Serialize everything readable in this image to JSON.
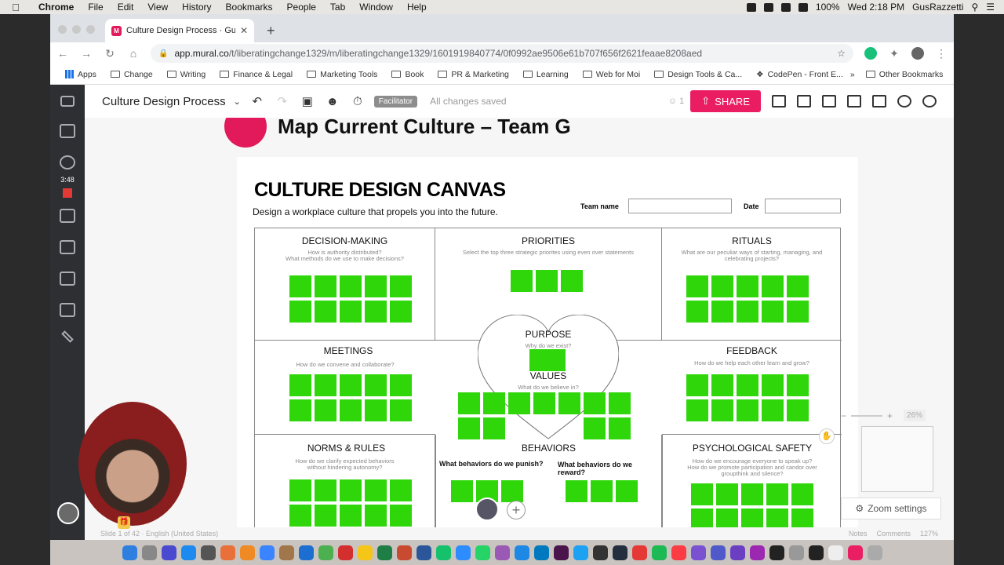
{
  "menubar": {
    "app": "Chrome",
    "items": [
      "File",
      "Edit",
      "View",
      "History",
      "Bookmarks",
      "People",
      "Tab",
      "Window",
      "Help"
    ],
    "battery": "100%",
    "clock": "Wed 2:18 PM",
    "user": "GusRazzetti"
  },
  "browser": {
    "tab_title": "Culture Design Process · Gust",
    "tab_favicon": "M",
    "url_host": "app.mural.co",
    "url_path": "/t/liberatingchange1329/m/liberatingchange1329/1601919840774/0f0992ae9506e61b707f656f2621feaae8208aed",
    "bookmarks": [
      "Apps",
      "Change",
      "Writing",
      "Finance & Legal",
      "Marketing Tools",
      "Book",
      "PR & Marketing",
      "Learning",
      "Web for Moi",
      "Design Tools & Ca...",
      "CodePen - Front E..."
    ],
    "bookmarks_more": "»",
    "other_bookmarks": "Other Bookmarks"
  },
  "recording_time": "3:48",
  "mural": {
    "title": "Culture Design Process",
    "facilitator": "Facilitator",
    "saved_status": "All changes saved",
    "user_count": "1",
    "share_label": "SHARE",
    "section_heading": "Map Current Culture – Team G",
    "canvas_title": "CULTURE DESIGN CANVAS",
    "canvas_subtitle": "Design a workplace culture that propels you into the future.",
    "team_name_label": "Team name",
    "date_label": "Date",
    "sections": {
      "decision": {
        "title": "DECISION-MAKING",
        "sub1": "How is authority distributed?",
        "sub2": "What methods do we use to make decisions?"
      },
      "priorities": {
        "title": "PRIORITIES",
        "sub1": "Select the top three strategic priorites using even over statements"
      },
      "rituals": {
        "title": "RITUALS",
        "sub1": "What are our peculiar ways of starting, managing, and",
        "sub2": "celebrating projects?"
      },
      "purpose": {
        "title": "PURPOSE",
        "sub1": "Why do we exist?"
      },
      "values": {
        "title": "VALUES",
        "sub1": "What do we believe in?"
      },
      "meetings": {
        "title": "MEETINGS",
        "sub1": "How do we convene and collaborate?"
      },
      "feedback": {
        "title": "FEEDBACK",
        "sub1": "How do we help each other learn and grow?"
      },
      "norms": {
        "title": "NORMS & RULES",
        "sub1": "How do we clarify expected behaviors",
        "sub2": "without hindering autonomy?"
      },
      "behaviors": {
        "title": "BEHAVIORS",
        "q1": "What behaviors do we punish?",
        "q2": "What behaviors do we reward?"
      },
      "psych": {
        "title": "PSYCHOLOGICAL SAFETY",
        "sub1": "How do we encourage everyone to speak up?",
        "sub2": "How do we promote participation and candor over",
        "sub3": "groupthink and silence?"
      }
    },
    "zoom_percent": "26%",
    "zoom_settings": "Zoom settings",
    "status_left": "Slide 1 of 42 · English (United States)",
    "status_notes": "Notes",
    "status_comments": "Comments",
    "status_zoom": "127%"
  }
}
